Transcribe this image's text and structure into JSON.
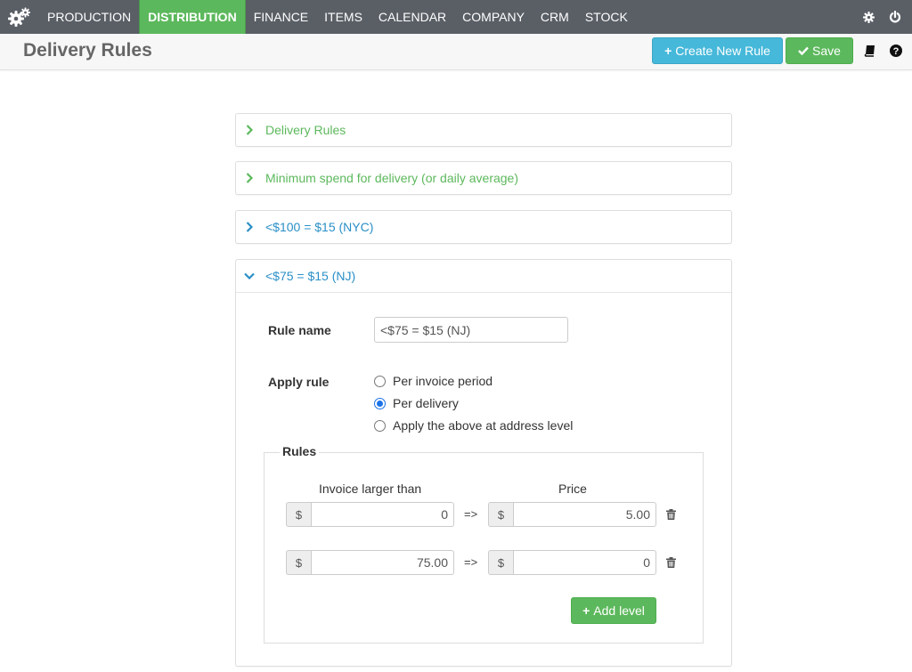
{
  "nav": {
    "items": [
      "PRODUCTION",
      "DISTRIBUTION",
      "FINANCE",
      "ITEMS",
      "CALENDAR",
      "COMPANY",
      "CRM",
      "STOCK"
    ],
    "active": "DISTRIBUTION"
  },
  "header": {
    "title": "Delivery Rules",
    "create_label": "Create New Rule",
    "save_label": "Save"
  },
  "panels": {
    "p1": {
      "label": "Delivery Rules"
    },
    "p2": {
      "label": "Minimum spend for delivery (or daily average)"
    },
    "p3": {
      "label": "<$100 = $15 (NYC)"
    },
    "p4": {
      "label": "<$75 = $15 (NJ)"
    }
  },
  "form": {
    "rule_name_label": "Rule name",
    "rule_name_value": "<$75 = $15 (NJ)",
    "apply_rule_label": "Apply rule",
    "options": [
      "Per invoice period",
      "Per delivery",
      "Apply the above at address level"
    ],
    "selected": "Per delivery"
  },
  "rules": {
    "legend": "Rules",
    "col_invoice": "Invoice larger than",
    "col_price": "Price",
    "currency": "$",
    "arrow": "=>",
    "rows": [
      {
        "invoice": "0",
        "price": "5.00"
      },
      {
        "invoice": "75.00",
        "price": "0"
      }
    ],
    "add_label": "Add level"
  },
  "colors": {
    "nav_bg": "#5a5f66",
    "active_green": "#5cb85c",
    "info_blue": "#46b8da",
    "link_blue": "#2a8fc7"
  }
}
